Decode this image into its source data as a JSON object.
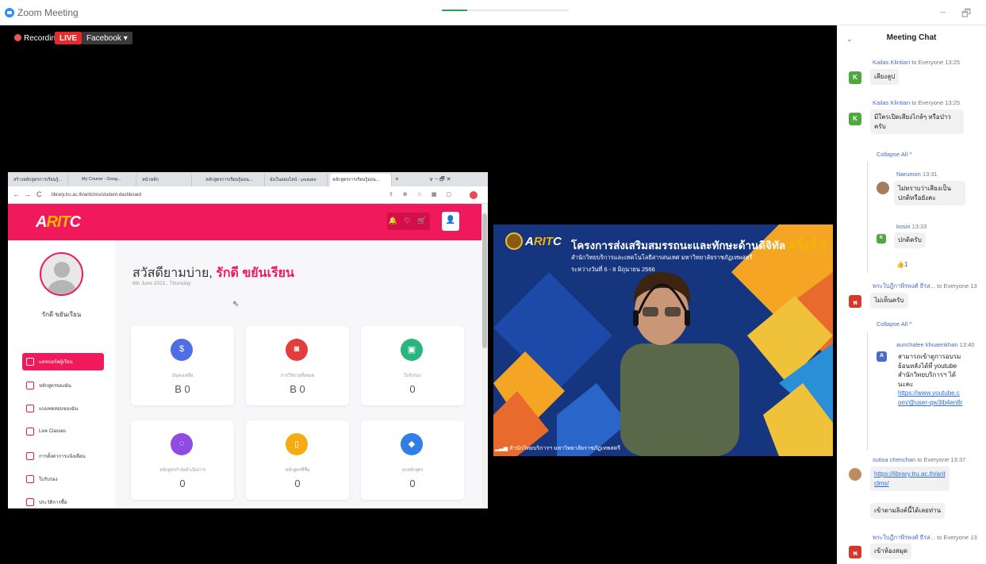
{
  "window": {
    "title": "Zoom Meeting",
    "minimize": "−",
    "restore": "🗗"
  },
  "controls": {
    "recording": "Recording",
    "live": "LIVE",
    "facebook": "Facebook ▾"
  },
  "browser": {
    "tabs": [
      {
        "label": "สร้างหลักสูตรการเรียนรู้..."
      },
      {
        "label": "My Course - Goog..."
      },
      {
        "label": "หน้าหลัก"
      },
      {
        "label": "หลักสูตรการเรียนรู้ออน..."
      },
      {
        "label": "ฉันในออนไลน์ - youtube"
      },
      {
        "label": "หลักสูตรการเรียนรู้ออน..."
      }
    ],
    "newtab": "+",
    "url": "library.tru.ac.th/aritclms/student-dashboard",
    "nav": {
      "back": "←",
      "forward": "→",
      "reload": "C"
    },
    "window_controls": "∨  −  🗗  ✕"
  },
  "site": {
    "logo_a": "A",
    "logo_b": "RIT",
    "logo_c": "C",
    "header_icons": "🔔 ♡ 🛒",
    "user_icon": "👤",
    "username": "รักดี ขยันเรียน",
    "menu": [
      {
        "label": "แดชบอร์ดผู้เรียน"
      },
      {
        "label": "หลักสูตรของฉัน"
      },
      {
        "label": "แบบทดสอบของฉัน"
      },
      {
        "label": "Live Classes"
      },
      {
        "label": "การตั้งค่าการแจ้งเตือน"
      },
      {
        "label": "ใบรับรอง"
      },
      {
        "label": "ประวัติการซื้อ"
      }
    ],
    "greeting": "สวัสดียามบ่าย,",
    "greeting_name": "รักดี ขยันเรียน",
    "date": "8th June 2023 , Thursday",
    "cards": [
      {
        "label": "เงินคงเหลือ",
        "value": "B 0",
        "icon": "wallet-icon",
        "color": "#4f6de4"
      },
      {
        "label": "การใช้จ่ายทั้งหมด",
        "value": "B 0",
        "icon": "camera-icon",
        "color": "#e53d3d"
      },
      {
        "label": "ใบรับรอง",
        "value": "0",
        "icon": "certificate-icon",
        "color": "#28b67e"
      },
      {
        "label": "หลักสูตรกำลังดำเนินการ",
        "value": "0",
        "icon": "spinner-icon",
        "color": "#8f4be3"
      },
      {
        "label": "หลักสูตรที่ซื้อ",
        "value": "0",
        "icon": "book-icon",
        "color": "#f4ac15"
      },
      {
        "label": "จบหลักสูตร",
        "value": "0",
        "icon": "graduation-icon",
        "color": "#2f7fe5"
      }
    ]
  },
  "video": {
    "logo_a": "A",
    "logo_b": "RIT",
    "logo_c": "C",
    "title": "โครงการส่งเสริมสมรรถนะและทักษะด้านดิจิทัล",
    "title_highlight": "ครั้งที่ 3",
    "subtitle": "สำนักวิทยบริการและเทคโนโลยีสารสนเทศ มหาวิทยาลัยราชภัฏเทพสตรี",
    "date": "ระหว่างวันที่ 6 - 8 มิถุนายน 2566",
    "caption": "สำนักวิทยบริการฯ มหาวิทยาลัยราชภัฏเทพสตรี"
  },
  "chat": {
    "title": "Meeting Chat",
    "collapse_toggle": "⌄",
    "collapse_all": "Collapse All ^",
    "to_everyone": "to Everyone",
    "messages": [
      {
        "sender": "Kailas Klintian",
        "time": "13:25",
        "avatar": "K",
        "text": "เสียงลูป"
      },
      {
        "sender": "Kailas Klintian",
        "time": "13:25",
        "avatar": "K",
        "text": "มีใครเปิดเสียงไกล้ๆ หรือป่าวครับ"
      },
      {
        "sender": "Narumon",
        "time": "13:31",
        "text": "ไม่ทราบว่าเสียงเป็นปกติหรือยังคะ"
      },
      {
        "sender": "kosin",
        "time": "13:33",
        "avatar": "K",
        "text": "ปกติครับ"
      },
      {
        "reaction": "👍1"
      },
      {
        "sender": "พระใบฎีกาพีรพงศ์ ธีรส...",
        "time": "13",
        "avatar": "พ",
        "text": "ไม่เห็นครับ"
      },
      {
        "sender": "aunchalee khuaenkhan",
        "time": "13:40",
        "avatar": "A",
        "text": "สามารถเข้าดูการอบรมย้อนหลังได้ที่ youtube สำนักวิทยบริการฯ ได้นะคะ",
        "link": "https://www.youtube.com/@user-qw3tb4en8r"
      },
      {
        "sender": "sutisa chenchan",
        "time": "13:37",
        "link": "https://library.tru.ac.th/aritclms/",
        "text": "เข้าตามลิงค์นี้ได้เลยท่าน"
      },
      {
        "sender": "พระใบฎีกาพีรพงศ์ ธีรส...",
        "time": "13",
        "avatar": "พ",
        "text": "เข้าห้องสมุด"
      }
    ]
  },
  "colors": {
    "brand": "#f0195b",
    "chat_link": "#4a6bc9",
    "live": "#e32b2b"
  }
}
